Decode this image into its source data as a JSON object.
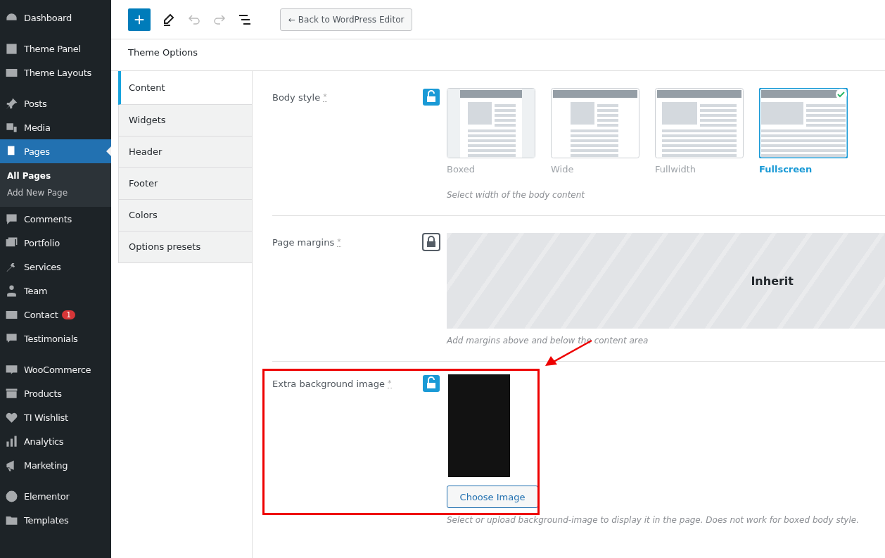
{
  "sidebar": {
    "groups": [
      {
        "items": [
          {
            "label": "Dashboard",
            "selected": false
          }
        ]
      },
      {
        "items": [
          {
            "label": "Theme Panel",
            "selected": false
          },
          {
            "label": "Theme Layouts",
            "selected": false
          }
        ]
      },
      {
        "items": [
          {
            "label": "Posts",
            "selected": false
          },
          {
            "label": "Media",
            "selected": false
          },
          {
            "label": "Pages",
            "selected": true,
            "children": [
              {
                "label": "All Pages",
                "selected": true
              },
              {
                "label": "Add New Page",
                "selected": false
              }
            ]
          },
          {
            "label": "Comments",
            "selected": false
          },
          {
            "label": "Portfolio",
            "selected": false
          },
          {
            "label": "Services",
            "selected": false
          },
          {
            "label": "Team",
            "selected": false
          },
          {
            "label": "Contact",
            "selected": false,
            "badge": "1"
          },
          {
            "label": "Testimonials",
            "selected": false
          }
        ]
      },
      {
        "items": [
          {
            "label": "WooCommerce",
            "selected": false
          },
          {
            "label": "Products",
            "selected": false
          },
          {
            "label": "TI Wishlist",
            "selected": false
          },
          {
            "label": "Analytics",
            "selected": false
          },
          {
            "label": "Marketing",
            "selected": false
          }
        ]
      },
      {
        "items": [
          {
            "label": "Elementor",
            "selected": false
          },
          {
            "label": "Templates",
            "selected": false
          }
        ]
      }
    ]
  },
  "toolbar": {
    "undo_disabled": true,
    "redo_disabled": true,
    "back_button": "← Back to WordPress Editor"
  },
  "panel_title": "Theme Options",
  "tabs": [
    {
      "label": "Content",
      "selected": true
    },
    {
      "label": "Widgets",
      "selected": false
    },
    {
      "label": "Header",
      "selected": false
    },
    {
      "label": "Footer",
      "selected": false
    },
    {
      "label": "Colors",
      "selected": false
    },
    {
      "label": "Options presets",
      "selected": false
    }
  ],
  "settings": [
    {
      "kind": "layout",
      "label": "Body style",
      "required_mark": "*",
      "locked": false,
      "options": [
        {
          "kind": "boxed",
          "label": "Boxed",
          "selected": false
        },
        {
          "kind": "wide",
          "label": "Wide",
          "selected": false
        },
        {
          "kind": "fullwidth",
          "label": "Fullwidth",
          "selected": false
        },
        {
          "kind": "fullscreen",
          "label": "Fullscreen",
          "selected": true
        }
      ],
      "hint": "Select width of the body content"
    },
    {
      "kind": "inherit",
      "label": "Page margins",
      "required_mark": "*",
      "locked": true,
      "value": "Inherit",
      "hint": "Add margins above and below the content area"
    },
    {
      "kind": "image",
      "label": "Extra background image",
      "required_mark": "*",
      "locked": false,
      "button": "Choose Image",
      "hint": "Select or upload background-image to display it in the page. Does not work for boxed body style.",
      "highlighted": true
    }
  ]
}
